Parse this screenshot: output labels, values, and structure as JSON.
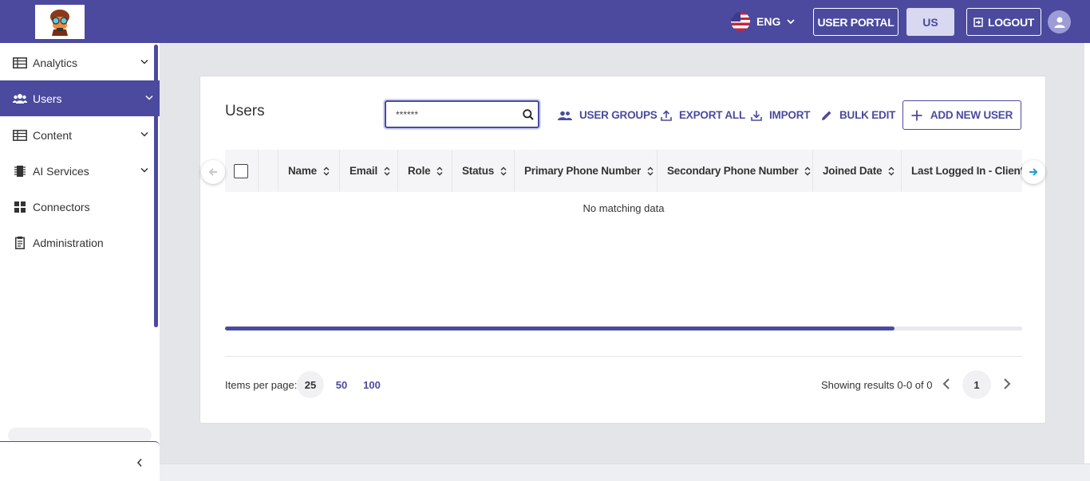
{
  "header": {
    "language": "ENG",
    "user_portal": "USER PORTAL",
    "region": "US",
    "logout": "LOGOUT"
  },
  "sidebar": {
    "items": [
      {
        "label": "Analytics"
      },
      {
        "label": "Users"
      },
      {
        "label": "Content"
      },
      {
        "label": "AI Services"
      },
      {
        "label": "Connectors"
      },
      {
        "label": "Administration"
      }
    ]
  },
  "main": {
    "title": "Users",
    "search_value": "******",
    "actions": {
      "user_groups": "USER GROUPS",
      "export_all": "EXPORT ALL",
      "import": "IMPORT",
      "bulk_edit": "BULK EDIT",
      "add_new_user": "ADD NEW USER"
    },
    "table": {
      "columns": [
        "Name",
        "Email",
        "Role",
        "Status",
        "Primary Phone Number",
        "Secondary Phone Number",
        "Joined Date",
        "Last Logged In - Client"
      ],
      "empty_text": "No matching data",
      "scroll_position": 0.84
    },
    "pagination": {
      "items_per_page_label": "Items per page:",
      "options": [
        "25",
        "50",
        "100"
      ],
      "selected": "25",
      "results_text": "Showing results 0-0 of 0",
      "current_page": "1"
    }
  },
  "colors": {
    "brand": "#4b4a9e",
    "background": "#e4e5e8"
  }
}
